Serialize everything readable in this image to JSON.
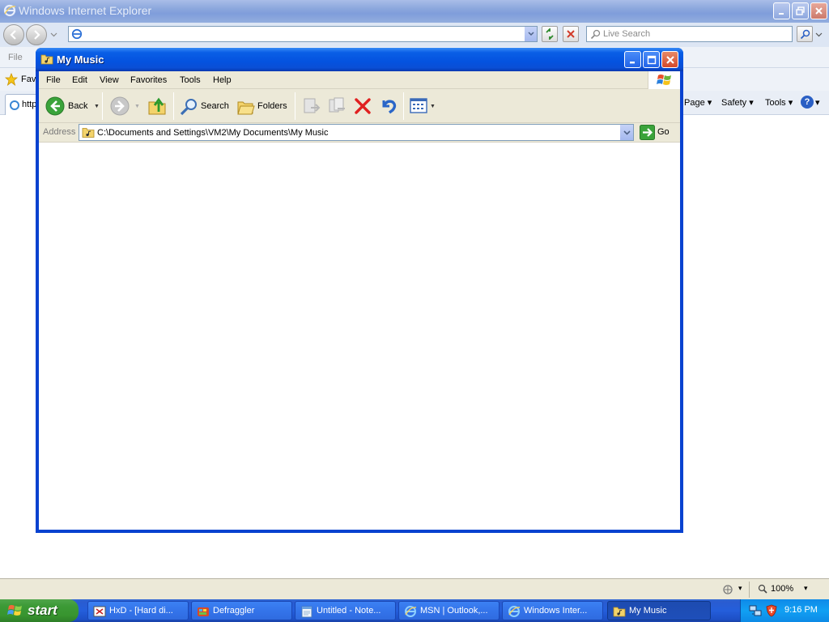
{
  "ie": {
    "title": "Windows Internet Explorer",
    "search_placeholder": "Live Search",
    "menu_file": "File",
    "favorites_label": "Fav",
    "tab_label": "http",
    "cmd_page": "Page",
    "cmd_safety": "Safety",
    "cmd_tools": "Tools",
    "zoom": "100%"
  },
  "window": {
    "title": "My Music",
    "menus": [
      "File",
      "Edit",
      "View",
      "Favorites",
      "Tools",
      "Help"
    ],
    "toolbar": {
      "back": "Back",
      "search": "Search",
      "folders": "Folders"
    },
    "address_label": "Address",
    "address_value": "C:\\Documents and Settings\\VM2\\My Documents\\My Music",
    "go_label": "Go"
  },
  "taskbar": {
    "start": "start",
    "tasks": [
      {
        "label": "HxD - [Hard di..."
      },
      {
        "label": "Defraggler"
      },
      {
        "label": "Untitled - Note..."
      },
      {
        "label": "MSN | Outlook,..."
      },
      {
        "label": "Windows Inter..."
      },
      {
        "label": "My Music"
      }
    ],
    "clock": "9:16 PM"
  },
  "colors": {
    "xp_blue": "#0842d0",
    "taskbar_blue": "#245edb",
    "start_green": "#3c9a36",
    "delete_red": "#e02020"
  }
}
